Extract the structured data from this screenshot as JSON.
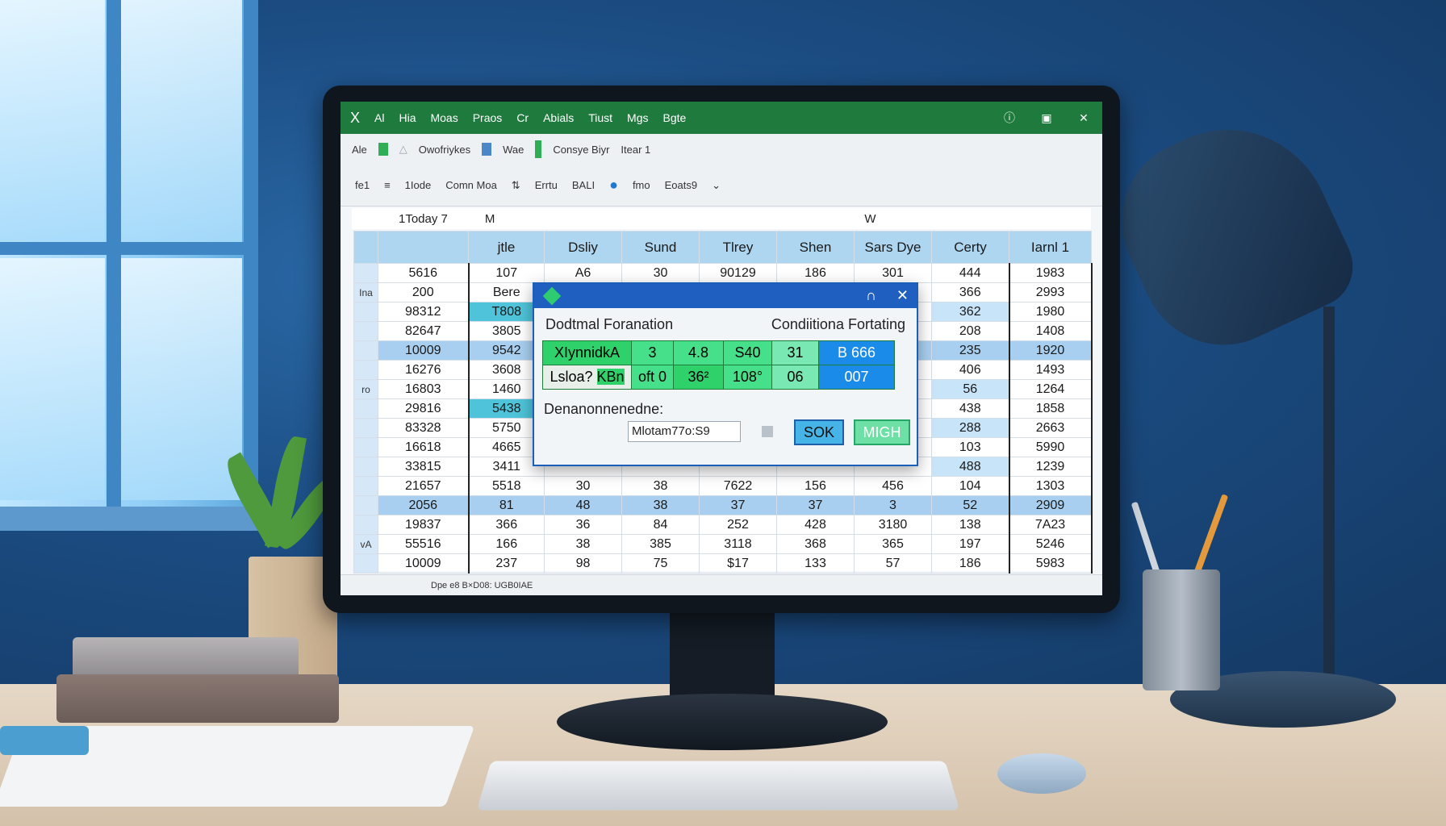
{
  "titlebar": {
    "close": "X",
    "tabs": [
      "Al",
      "Hia",
      "Moas",
      "Praos",
      "Cr",
      "Abials",
      "Tiust",
      "Mgs",
      "Bgte"
    ]
  },
  "ribbon1": {
    "items": [
      "Ale",
      "Owofriykes",
      "Wae",
      "Consye Biyr",
      "Itear 1"
    ]
  },
  "ribbon2": {
    "items": [
      "fe1",
      "1Iode",
      "Comn Moa",
      "Errtu",
      "BALI",
      "fmo",
      "Eoats9"
    ]
  },
  "formulabar": {
    "cell": "1Today 7",
    "a": "M",
    "b": "W"
  },
  "grid": {
    "headers": [
      "",
      "jtle",
      "Dsliy",
      "Sund",
      "Tlrey",
      "Shen",
      "Sars Dye",
      "Certy",
      "Iarnl 1"
    ],
    "rows": [
      {
        "n": "",
        "c": [
          "5616",
          "107",
          "A6",
          "30",
          "90129",
          "186",
          "301",
          "444",
          "1983"
        ]
      },
      {
        "n": "Ina",
        "c": [
          "200",
          "Bere",
          "",
          "",
          "",
          "",
          "",
          "366",
          "2993"
        ]
      },
      {
        "n": "",
        "c": [
          "98312",
          "T808",
          "",
          "",
          "",
          "",
          "",
          "362",
          "1980"
        ]
      },
      {
        "n": "",
        "c": [
          "82647",
          "3805",
          "",
          "",
          "",
          "",
          "",
          "208",
          "1408"
        ]
      },
      {
        "n": "",
        "c": [
          "10009",
          "9542",
          "",
          "",
          "",
          "",
          "",
          "235",
          "1920"
        ]
      },
      {
        "n": "",
        "c": [
          "16276",
          "3608",
          "",
          "",
          "",
          "",
          "",
          "406",
          "1493"
        ]
      },
      {
        "n": "ro",
        "c": [
          "16803",
          "1460",
          "",
          "",
          "",
          "",
          "",
          "56",
          "1264"
        ]
      },
      {
        "n": "",
        "c": [
          "29816",
          "5438",
          "",
          "",
          "",
          "",
          "",
          "438",
          "1858"
        ]
      },
      {
        "n": "",
        "c": [
          "83328",
          "5750",
          "",
          "",
          "",
          "",
          "",
          "288",
          "2663"
        ]
      },
      {
        "n": "",
        "c": [
          "16618",
          "4665",
          "",
          "",
          "",
          "",
          "",
          "103",
          "5990"
        ]
      },
      {
        "n": "",
        "c": [
          "33815",
          "3411",
          "",
          "",
          "",
          "",
          "",
          "488",
          "1239"
        ]
      },
      {
        "n": "",
        "c": [
          "21657",
          "5518",
          "30",
          "38",
          "7622",
          "156",
          "456",
          "104",
          "1303"
        ]
      },
      {
        "n": "",
        "c": [
          "2056",
          "81",
          "48",
          "38",
          "37",
          "37",
          "3",
          "52",
          "2909"
        ]
      },
      {
        "n": "",
        "c": [
          "19837",
          "366",
          "36",
          "84",
          "252",
          "428",
          "3180",
          "138",
          "7A23"
        ]
      },
      {
        "n": "vA",
        "c": [
          "55516",
          "166",
          "38",
          "385",
          "3118",
          "368",
          "365",
          "197",
          "5246"
        ]
      },
      {
        "n": "",
        "c": [
          "10009",
          "237",
          "98",
          "75",
          "$17",
          "133",
          "57",
          "186",
          "5983"
        ]
      }
    ]
  },
  "status": {
    "text": "Dpe e8 B×D08: UGB0IAE"
  },
  "dialog": {
    "title_left": "Dodtmal Foranation",
    "title_right": "Condiitiona Fortating",
    "row1": [
      "XIynnidkA",
      "3",
      "4.8",
      "S40",
      "31",
      "B 666"
    ],
    "row2": [
      "Lsloa?",
      "KBn",
      "oft 0",
      "36²",
      "108°",
      "06",
      "007"
    ],
    "label": "Denanonnenedne:",
    "input_value": "Mlotam77o:S9",
    "ok": "SOK",
    "migh": "MIGH"
  }
}
